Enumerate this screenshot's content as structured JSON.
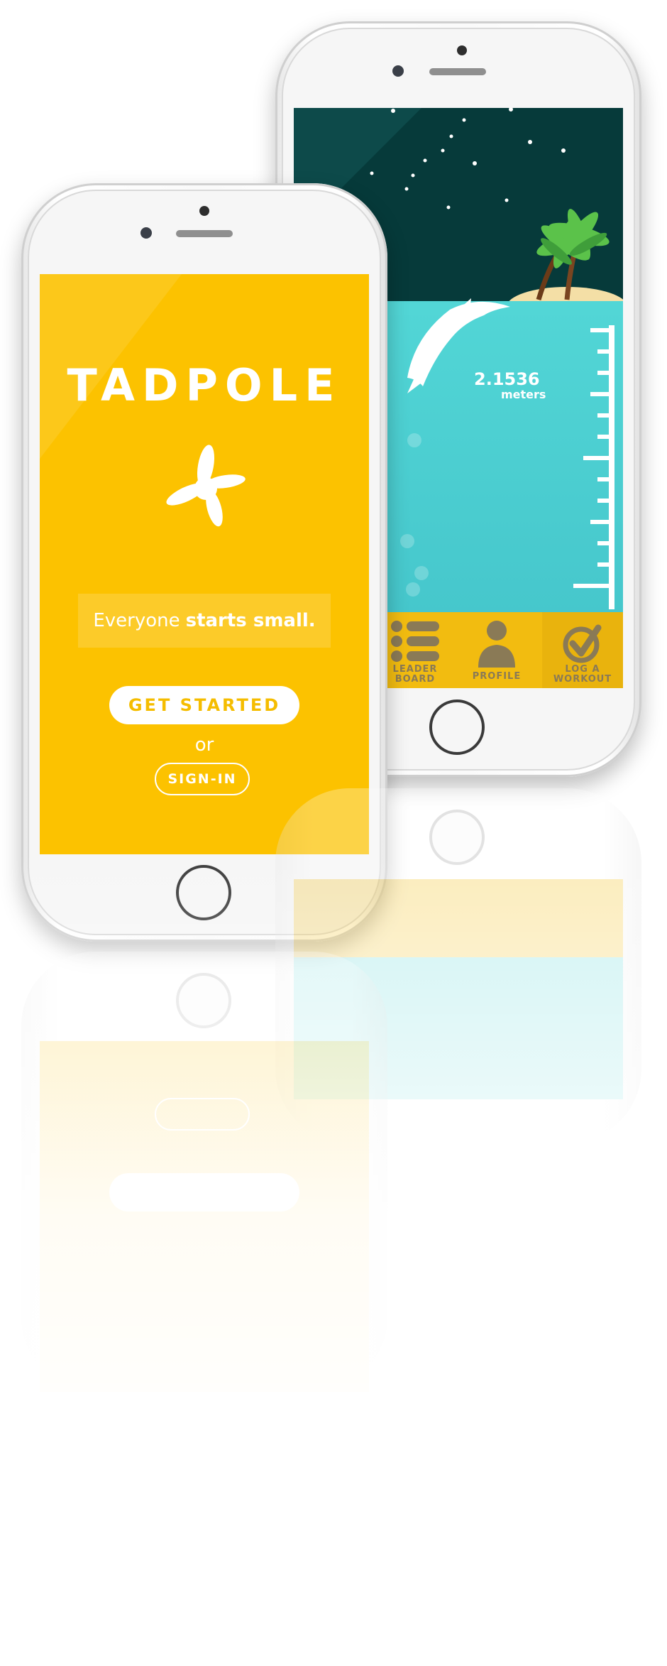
{
  "welcome_screen": {
    "brand": "TADPOLE",
    "tagline_regular": "Everyone",
    "tagline_bold": "starts small.",
    "get_started_label": "GET STARTED",
    "or_label": "or",
    "sign_in_label": "SIGN-IN",
    "brand_color": "#fcc200"
  },
  "progress_screen": {
    "distance_value": "2.1536",
    "distance_unit": "meters",
    "night_sky_color": "#063a3a",
    "water_color": "#4ed4d4",
    "tabs": [
      {
        "label_line1": "LEADER",
        "label_line2": "BOARD",
        "icon": "list-icon"
      },
      {
        "label_line1": "PROFILE",
        "label_line2": "",
        "icon": "person-icon"
      },
      {
        "label_line1": "LOG A",
        "label_line2": "WORKOUT",
        "icon": "check-icon"
      }
    ],
    "tab_bar_color": "#f2bc10"
  }
}
